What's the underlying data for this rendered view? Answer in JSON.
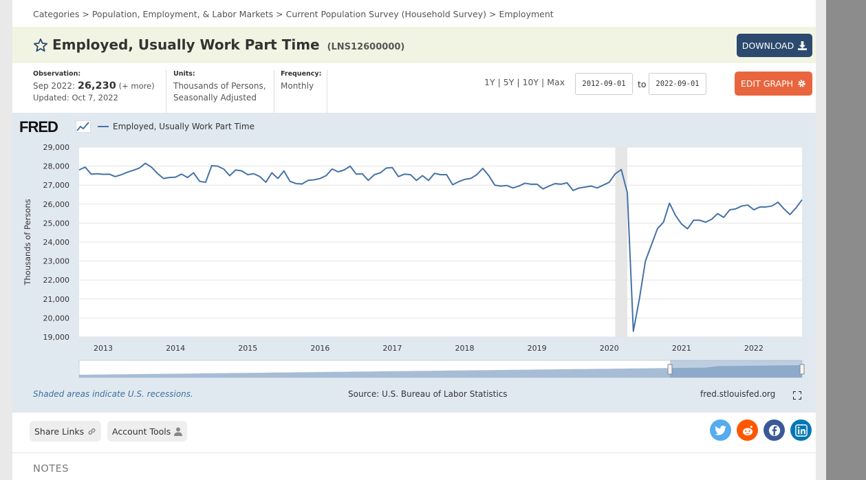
{
  "breadcrumb": {
    "items": [
      "Categories",
      "Population, Employment, & Labor Markets",
      "Current Population Survey (Household Survey)",
      "Employment"
    ],
    "separator": ">"
  },
  "header": {
    "title": "Employed, Usually Work Part Time",
    "series_id": "(LNS12600000)",
    "download_label": "DOWNLOAD",
    "edit_label": "EDIT GRAPH"
  },
  "meta": {
    "observation_label": "Observation:",
    "observation_date": "Sep 2022:",
    "observation_value": "26,230",
    "observation_more": "(+ more)",
    "updated": "Updated: Oct 7, 2022",
    "units_label": "Units:",
    "units_line1": "Thousands of Persons,",
    "units_line2": "Seasonally Adjusted",
    "frequency_label": "Frequency:",
    "frequency_value": "Monthly"
  },
  "range": {
    "links": [
      "1Y",
      "5Y",
      "10Y",
      "Max"
    ],
    "start": "2012-09-01",
    "to_label": "to",
    "end": "2022-09-01"
  },
  "graph": {
    "logo": "FRED",
    "recession_note": "Shaded areas indicate U.S. recessions.",
    "source": "Source: U.S. Bureau of Labor Statistics",
    "url": "fred.stlouisfed.org"
  },
  "chart_data": {
    "type": "line",
    "title": "",
    "xlabel": "",
    "ylabel": "Thousands of Persons",
    "ylim": [
      19000,
      29000
    ],
    "yticks": [
      19000,
      20000,
      21000,
      22000,
      23000,
      24000,
      25000,
      26000,
      27000,
      28000,
      29000
    ],
    "ytick_labels": [
      "19,000",
      "20,000",
      "21,000",
      "22,000",
      "23,000",
      "24,000",
      "25,000",
      "26,000",
      "27,000",
      "28,000",
      "29,000"
    ],
    "xtick_labels": [
      "2013",
      "2014",
      "2015",
      "2016",
      "2017",
      "2018",
      "2019",
      "2020",
      "2021",
      "2022"
    ],
    "xlim": [
      "2012-09-01",
      "2022-09-01"
    ],
    "recessions": [
      {
        "start": "2020-02-01",
        "end": "2020-04-01"
      }
    ],
    "grid": true,
    "legend_position": "top-left",
    "color": "#4572a7",
    "series": [
      {
        "name": "Employed, Usually Work Part Time",
        "x": [
          "2012-09",
          "2012-10",
          "2012-11",
          "2012-12",
          "2013-01",
          "2013-02",
          "2013-03",
          "2013-04",
          "2013-05",
          "2013-06",
          "2013-07",
          "2013-08",
          "2013-09",
          "2013-10",
          "2013-11",
          "2013-12",
          "2014-01",
          "2014-02",
          "2014-03",
          "2014-04",
          "2014-05",
          "2014-06",
          "2014-07",
          "2014-08",
          "2014-09",
          "2014-10",
          "2014-11",
          "2014-12",
          "2015-01",
          "2015-02",
          "2015-03",
          "2015-04",
          "2015-05",
          "2015-06",
          "2015-07",
          "2015-08",
          "2015-09",
          "2015-10",
          "2015-11",
          "2015-12",
          "2016-01",
          "2016-02",
          "2016-03",
          "2016-04",
          "2016-05",
          "2016-06",
          "2016-07",
          "2016-08",
          "2016-09",
          "2016-10",
          "2016-11",
          "2016-12",
          "2017-01",
          "2017-02",
          "2017-03",
          "2017-04",
          "2017-05",
          "2017-06",
          "2017-07",
          "2017-08",
          "2017-09",
          "2017-10",
          "2017-11",
          "2017-12",
          "2018-01",
          "2018-02",
          "2018-03",
          "2018-04",
          "2018-05",
          "2018-06",
          "2018-07",
          "2018-08",
          "2018-09",
          "2018-10",
          "2018-11",
          "2018-12",
          "2019-01",
          "2019-02",
          "2019-03",
          "2019-04",
          "2019-05",
          "2019-06",
          "2019-07",
          "2019-08",
          "2019-09",
          "2019-10",
          "2019-11",
          "2019-12",
          "2020-01",
          "2020-02",
          "2020-03",
          "2020-04",
          "2020-05",
          "2020-06",
          "2020-07",
          "2020-08",
          "2020-09",
          "2020-10",
          "2020-11",
          "2020-12",
          "2021-01",
          "2021-02",
          "2021-03",
          "2021-04",
          "2021-05",
          "2021-06",
          "2021-07",
          "2021-08",
          "2021-09",
          "2021-10",
          "2021-11",
          "2021-12",
          "2022-01",
          "2022-02",
          "2022-03",
          "2022-04",
          "2022-05",
          "2022-06",
          "2022-07",
          "2022-08",
          "2022-09"
        ],
        "values": [
          27800,
          27950,
          27580,
          27600,
          27570,
          27580,
          27450,
          27550,
          27680,
          27780,
          27900,
          28150,
          27950,
          27620,
          27350,
          27400,
          27420,
          27580,
          27400,
          27650,
          27200,
          27150,
          28020,
          28000,
          27850,
          27500,
          27800,
          27750,
          27550,
          27600,
          27450,
          27150,
          27650,
          27350,
          27750,
          27200,
          27080,
          27060,
          27250,
          27280,
          27350,
          27500,
          27850,
          27700,
          27800,
          28000,
          27580,
          27600,
          27250,
          27550,
          27650,
          27900,
          27920,
          27450,
          27580,
          27550,
          27250,
          27500,
          27250,
          27620,
          27550,
          27550,
          27020,
          27180,
          27300,
          27350,
          27550,
          27880,
          27500,
          27000,
          26950,
          26980,
          26850,
          26950,
          27100,
          27050,
          27050,
          26800,
          26950,
          27080,
          27050,
          27120,
          26720,
          26850,
          26900,
          26950,
          26850,
          27000,
          27150,
          27600,
          27820,
          26600,
          19300,
          21000,
          23000,
          23850,
          24700,
          25050,
          26050,
          25400,
          24950,
          24700,
          25150,
          25150,
          25050,
          25200,
          25500,
          25300,
          25700,
          25750,
          25900,
          25950,
          25700,
          25850,
          25850,
          25900,
          26100,
          25750,
          25450,
          25800,
          26230
        ]
      }
    ]
  },
  "share": {
    "share_links": "Share Links",
    "account_tools": "Account Tools"
  },
  "notes": {
    "label": "NOTES"
  },
  "colors": {
    "line": "#4572a7",
    "download_button": "#2c4a6e",
    "edit_button": "#e8653e",
    "graph_bg": "#e1e9f0",
    "title_bg": "#f2f4e3"
  }
}
